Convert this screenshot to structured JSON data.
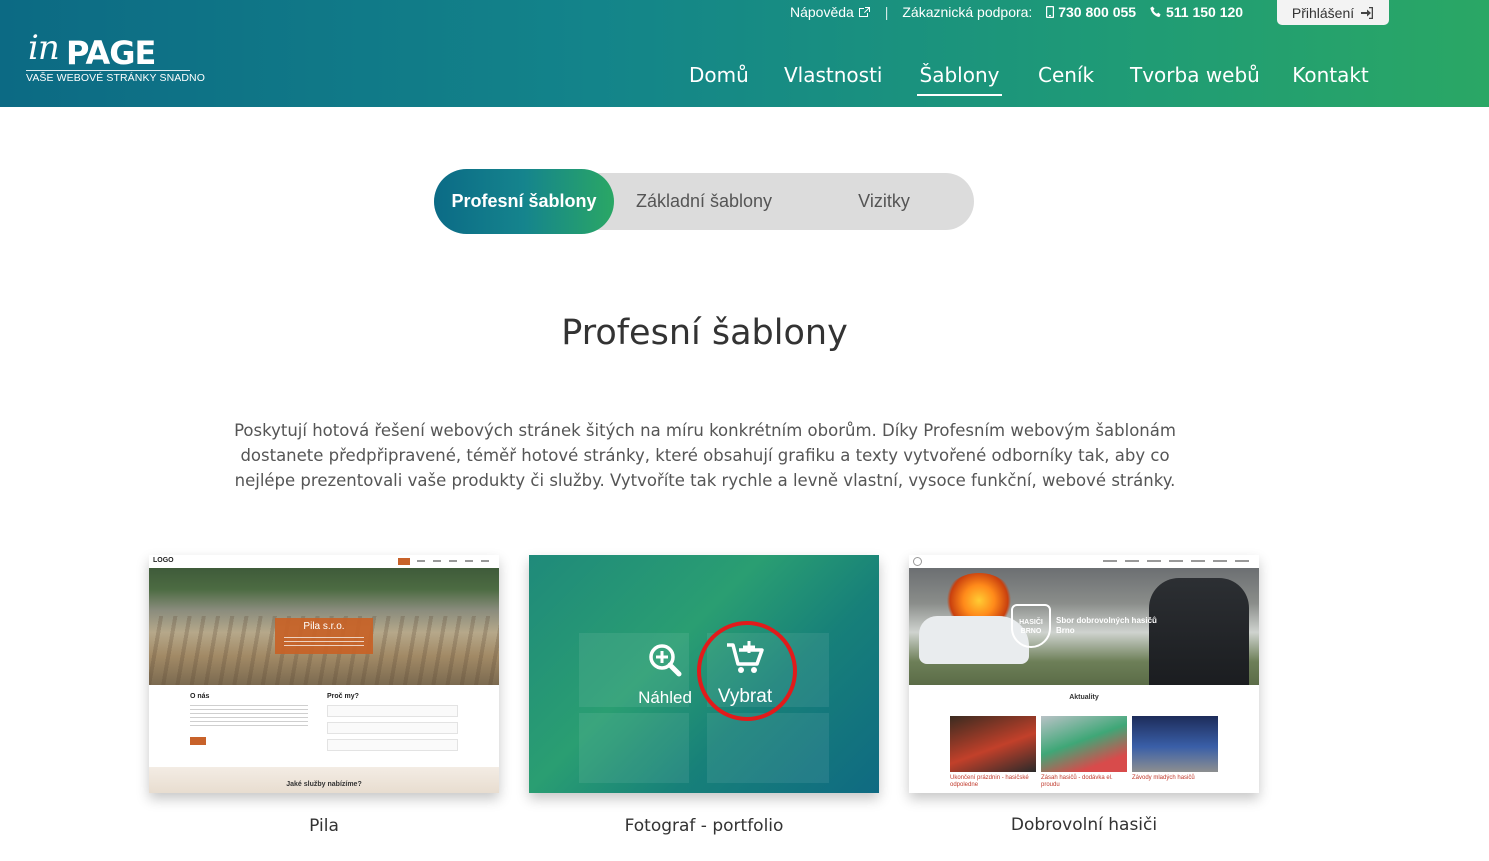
{
  "header": {
    "logo": {
      "prefix": "in",
      "main": "PAGE",
      "tagline": "VAŠE WEBOVÉ STRÁNKY SNADNO"
    },
    "topbar": {
      "help": "Nápověda",
      "support_label": "Zákaznická podpora:",
      "mobile": "730 800 055",
      "phone": "511 150 120",
      "login": "Přihlášení"
    },
    "nav": [
      "Domů",
      "Vlastnosti",
      "Šablony",
      "Ceník",
      "Tvorba webů",
      "Kontakt"
    ],
    "active_nav": "Šablony"
  },
  "tabs": {
    "items": [
      "Profesní šablony",
      "Základní šablony",
      "Vizitky"
    ],
    "active": "Profesní šablony"
  },
  "section": {
    "title": "Profesní šablony",
    "intro": "Poskytují hotová řešení webových stránek šitých na míru konkrétním oborům. Díky Profesním webovým šablonám dostanete předpřipravené, téměř hotové stránky, které obsahují grafiku a texty vytvořené odborníky tak, aby co nejlépe prezentovali vaše produkty či služby. Vytvoříte tak rychle a levně vlastní, vysoce funkční, webové stránky."
  },
  "templates": [
    {
      "name": "Pila",
      "thumb": {
        "logo": "LOGO",
        "hero_title": "Pila s.r.o.",
        "about": "O nás",
        "why": "Proč my?",
        "services": "Jaké služby nabízíme?"
      }
    },
    {
      "name": "Fotograf - portfolio",
      "overlay": {
        "preview": "Náhled",
        "select": "Vybrat"
      }
    },
    {
      "name": "Dobrovolní hasiči",
      "thumb": {
        "badge": "HASIČI BRNO",
        "hero_title": "Sbor dobrovolných hasičů Brno",
        "news": "Aktuality",
        "items": [
          "Ukončení prázdnin - hasičské odpoledne",
          "Zásah hasičů - dodávka el. proudu",
          "Závody mladých hasičů"
        ]
      }
    }
  ],
  "colors": {
    "brand_teal": "#0c6a84",
    "brand_green": "#2aa765",
    "highlight_ring": "#e11b1b"
  }
}
